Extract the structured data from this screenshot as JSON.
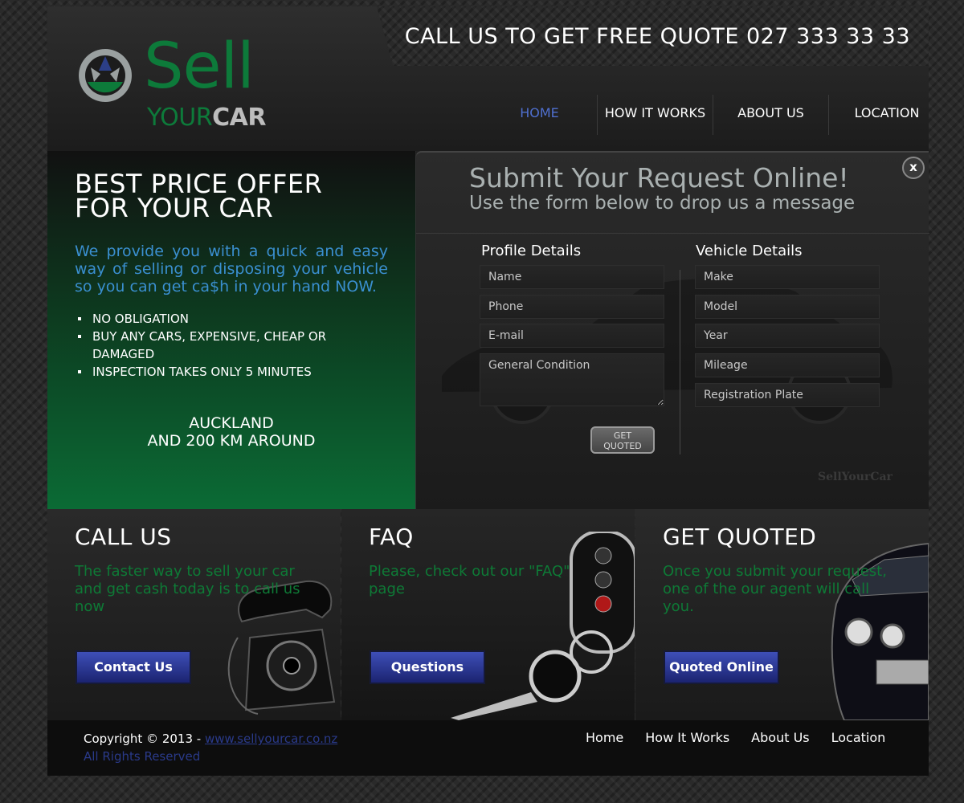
{
  "header": {
    "call_banner": "CALL US TO GET FREE QUOTE 027 333 33 33",
    "logo": {
      "word1": "Sell",
      "word2": "YOUR",
      "word3": "CAR"
    },
    "nav": [
      "HOME",
      "HOW IT WORKS",
      "ABOUT US",
      "LOCATION"
    ],
    "active_nav": "HOME"
  },
  "hero": {
    "title_line1": "BEST PRICE OFFER",
    "title_line2": "FOR YOUR CAR",
    "description": "We provide you with a quick and easy way of selling or disposing your vehicle so you can get ca$h in your hand NOW.",
    "bullets": [
      "NO OBLIGATION",
      "BUY ANY CARS, EXPENSIVE, CHEAP OR DAMAGED",
      "INSPECTION TAKES ONLY 5 MINUTES"
    ],
    "area_line1": "AUCKLAND",
    "area_line2": "AND 200 KM AROUND"
  },
  "form": {
    "close_label": "x",
    "title": "Submit Your Request Online!",
    "subtitle": "Use the form below to drop us a message",
    "profile_heading": "Profile Details",
    "vehicle_heading": "Vehicle Details",
    "profile_fields": {
      "name": "Name",
      "phone": "Phone",
      "email": "E-mail",
      "condition": "General Condition"
    },
    "vehicle_fields": {
      "make": "Make",
      "model": "Model",
      "year": "Year",
      "mileage": "Mileage",
      "plate": "Registration Plate"
    },
    "submit_line1": "GET",
    "submit_line2": "QUOTED",
    "watermark": "SellYourCar"
  },
  "features": [
    {
      "title": "CALL US",
      "text": "The faster way to sell your car and get cash today is to call us now",
      "button": "Contact Us",
      "art_icon": "telephone-icon"
    },
    {
      "title": "FAQ",
      "text": "Please, check out our \"FAQ\" page",
      "button": "Questions",
      "art_icon": "car-key-icon"
    },
    {
      "title": "GET QUOTED",
      "text": "Once you submit your request, one of the our agent will call you.",
      "button": "Quoted Online",
      "art_icon": "car-icon"
    }
  ],
  "footer": {
    "copyright_prefix": "Copyright © 2013 - ",
    "site_link": "www.sellyourcar.co.nz",
    "rights": "All Rights Reserved",
    "links": [
      "Home",
      "How It Works",
      "About Us",
      "Location"
    ]
  },
  "colors": {
    "brand_green": "#0d7a3a",
    "nav_active": "#4f6fcf",
    "hero_text_blue": "#3a8fd0",
    "button_blue": "#2b3a9c"
  }
}
